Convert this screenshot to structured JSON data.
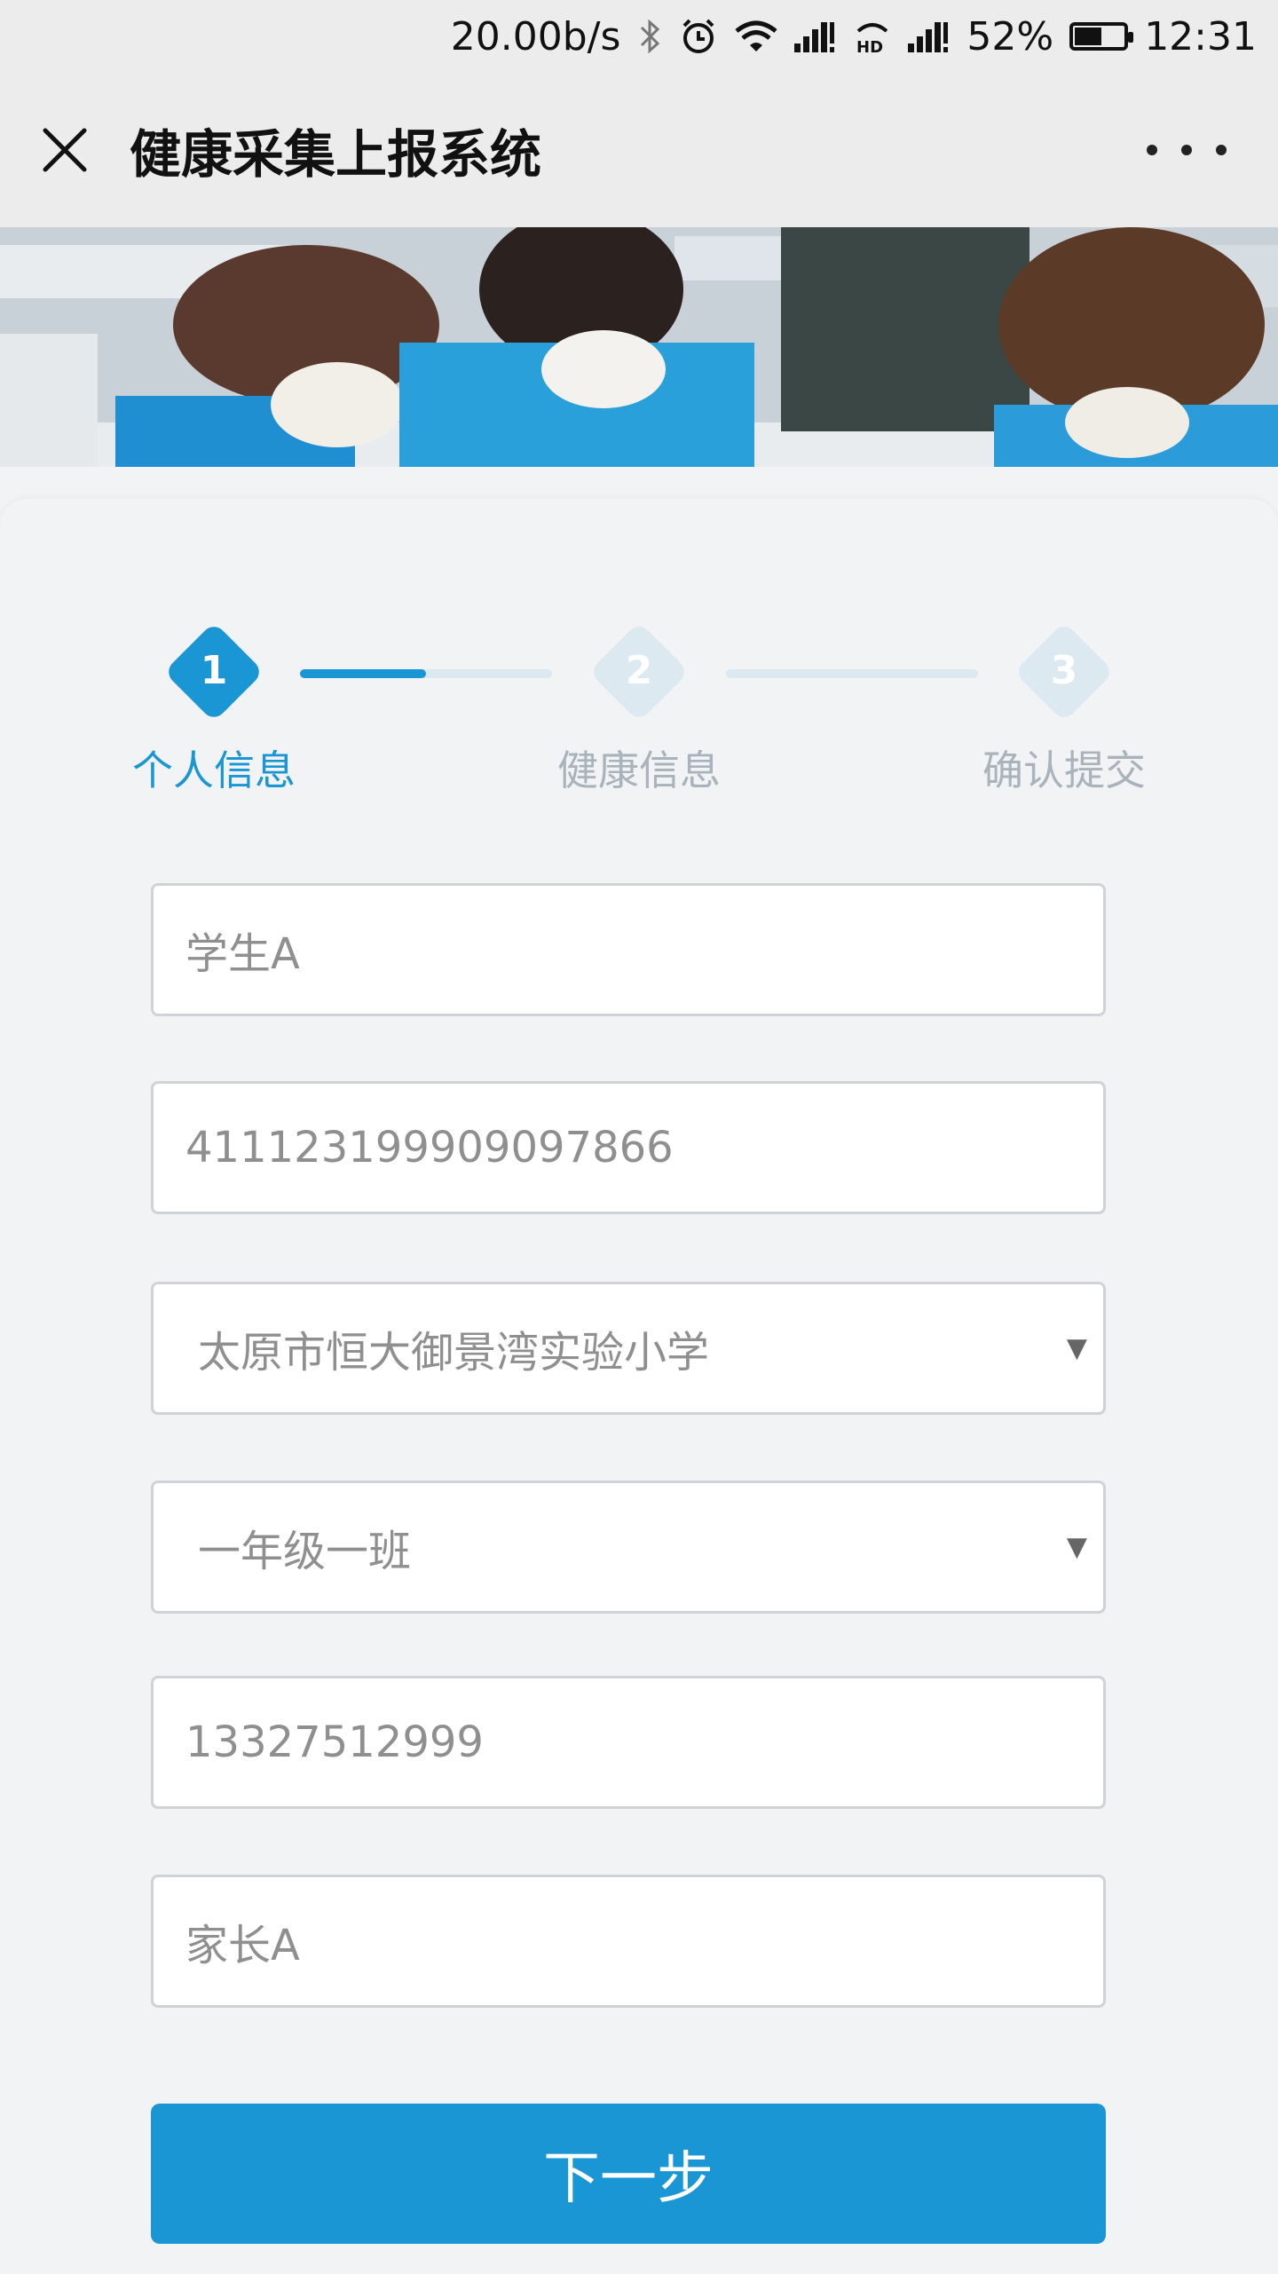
{
  "status_bar": {
    "speed": "20.00b/s",
    "battery_percent": "52%",
    "battery_level": 0.52,
    "time": "12:31",
    "icons": [
      "bluetooth-icon",
      "alarm-icon",
      "wifi-icon",
      "signal-icon",
      "hd-icon",
      "signal-icon-2",
      "battery-icon"
    ]
  },
  "header": {
    "title": "健康采集上报系统"
  },
  "stepper": {
    "steps": [
      {
        "number": "1",
        "label": "个人信息",
        "active": true
      },
      {
        "number": "2",
        "label": "健康信息",
        "active": false
      },
      {
        "number": "3",
        "label": "确认提交",
        "active": false
      }
    ],
    "progress_first_connector": 0.5,
    "colors": {
      "active": "#1a96d4",
      "inactive": "#dce9f1",
      "inactive_label": "#a9b3bb"
    }
  },
  "form": {
    "student_name": "学生A",
    "id_number": "411123199909097866",
    "school": "太原市恒大御景湾实验小学",
    "class": "一年级一班",
    "phone": "13327512999",
    "parent_name": "家长A"
  },
  "actions": {
    "next_label": "下一步"
  },
  "colors": {
    "accent": "#1a96d4",
    "background": "#f2f3f5"
  }
}
